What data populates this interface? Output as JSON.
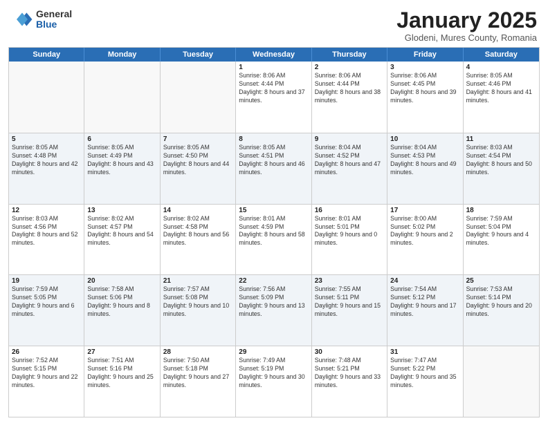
{
  "logo": {
    "general": "General",
    "blue": "Blue"
  },
  "header": {
    "month": "January 2025",
    "location": "Glodeni, Mures County, Romania"
  },
  "weekdays": [
    "Sunday",
    "Monday",
    "Tuesday",
    "Wednesday",
    "Thursday",
    "Friday",
    "Saturday"
  ],
  "weeks": [
    [
      {
        "day": "",
        "info": ""
      },
      {
        "day": "",
        "info": ""
      },
      {
        "day": "",
        "info": ""
      },
      {
        "day": "1",
        "info": "Sunrise: 8:06 AM\nSunset: 4:44 PM\nDaylight: 8 hours and 37 minutes."
      },
      {
        "day": "2",
        "info": "Sunrise: 8:06 AM\nSunset: 4:44 PM\nDaylight: 8 hours and 38 minutes."
      },
      {
        "day": "3",
        "info": "Sunrise: 8:06 AM\nSunset: 4:45 PM\nDaylight: 8 hours and 39 minutes."
      },
      {
        "day": "4",
        "info": "Sunrise: 8:05 AM\nSunset: 4:46 PM\nDaylight: 8 hours and 41 minutes."
      }
    ],
    [
      {
        "day": "5",
        "info": "Sunrise: 8:05 AM\nSunset: 4:48 PM\nDaylight: 8 hours and 42 minutes."
      },
      {
        "day": "6",
        "info": "Sunrise: 8:05 AM\nSunset: 4:49 PM\nDaylight: 8 hours and 43 minutes."
      },
      {
        "day": "7",
        "info": "Sunrise: 8:05 AM\nSunset: 4:50 PM\nDaylight: 8 hours and 44 minutes."
      },
      {
        "day": "8",
        "info": "Sunrise: 8:05 AM\nSunset: 4:51 PM\nDaylight: 8 hours and 46 minutes."
      },
      {
        "day": "9",
        "info": "Sunrise: 8:04 AM\nSunset: 4:52 PM\nDaylight: 8 hours and 47 minutes."
      },
      {
        "day": "10",
        "info": "Sunrise: 8:04 AM\nSunset: 4:53 PM\nDaylight: 8 hours and 49 minutes."
      },
      {
        "day": "11",
        "info": "Sunrise: 8:03 AM\nSunset: 4:54 PM\nDaylight: 8 hours and 50 minutes."
      }
    ],
    [
      {
        "day": "12",
        "info": "Sunrise: 8:03 AM\nSunset: 4:56 PM\nDaylight: 8 hours and 52 minutes."
      },
      {
        "day": "13",
        "info": "Sunrise: 8:02 AM\nSunset: 4:57 PM\nDaylight: 8 hours and 54 minutes."
      },
      {
        "day": "14",
        "info": "Sunrise: 8:02 AM\nSunset: 4:58 PM\nDaylight: 8 hours and 56 minutes."
      },
      {
        "day": "15",
        "info": "Sunrise: 8:01 AM\nSunset: 4:59 PM\nDaylight: 8 hours and 58 minutes."
      },
      {
        "day": "16",
        "info": "Sunrise: 8:01 AM\nSunset: 5:01 PM\nDaylight: 9 hours and 0 minutes."
      },
      {
        "day": "17",
        "info": "Sunrise: 8:00 AM\nSunset: 5:02 PM\nDaylight: 9 hours and 2 minutes."
      },
      {
        "day": "18",
        "info": "Sunrise: 7:59 AM\nSunset: 5:04 PM\nDaylight: 9 hours and 4 minutes."
      }
    ],
    [
      {
        "day": "19",
        "info": "Sunrise: 7:59 AM\nSunset: 5:05 PM\nDaylight: 9 hours and 6 minutes."
      },
      {
        "day": "20",
        "info": "Sunrise: 7:58 AM\nSunset: 5:06 PM\nDaylight: 9 hours and 8 minutes."
      },
      {
        "day": "21",
        "info": "Sunrise: 7:57 AM\nSunset: 5:08 PM\nDaylight: 9 hours and 10 minutes."
      },
      {
        "day": "22",
        "info": "Sunrise: 7:56 AM\nSunset: 5:09 PM\nDaylight: 9 hours and 13 minutes."
      },
      {
        "day": "23",
        "info": "Sunrise: 7:55 AM\nSunset: 5:11 PM\nDaylight: 9 hours and 15 minutes."
      },
      {
        "day": "24",
        "info": "Sunrise: 7:54 AM\nSunset: 5:12 PM\nDaylight: 9 hours and 17 minutes."
      },
      {
        "day": "25",
        "info": "Sunrise: 7:53 AM\nSunset: 5:14 PM\nDaylight: 9 hours and 20 minutes."
      }
    ],
    [
      {
        "day": "26",
        "info": "Sunrise: 7:52 AM\nSunset: 5:15 PM\nDaylight: 9 hours and 22 minutes."
      },
      {
        "day": "27",
        "info": "Sunrise: 7:51 AM\nSunset: 5:16 PM\nDaylight: 9 hours and 25 minutes."
      },
      {
        "day": "28",
        "info": "Sunrise: 7:50 AM\nSunset: 5:18 PM\nDaylight: 9 hours and 27 minutes."
      },
      {
        "day": "29",
        "info": "Sunrise: 7:49 AM\nSunset: 5:19 PM\nDaylight: 9 hours and 30 minutes."
      },
      {
        "day": "30",
        "info": "Sunrise: 7:48 AM\nSunset: 5:21 PM\nDaylight: 9 hours and 33 minutes."
      },
      {
        "day": "31",
        "info": "Sunrise: 7:47 AM\nSunset: 5:22 PM\nDaylight: 9 hours and 35 minutes."
      },
      {
        "day": "",
        "info": ""
      }
    ]
  ]
}
